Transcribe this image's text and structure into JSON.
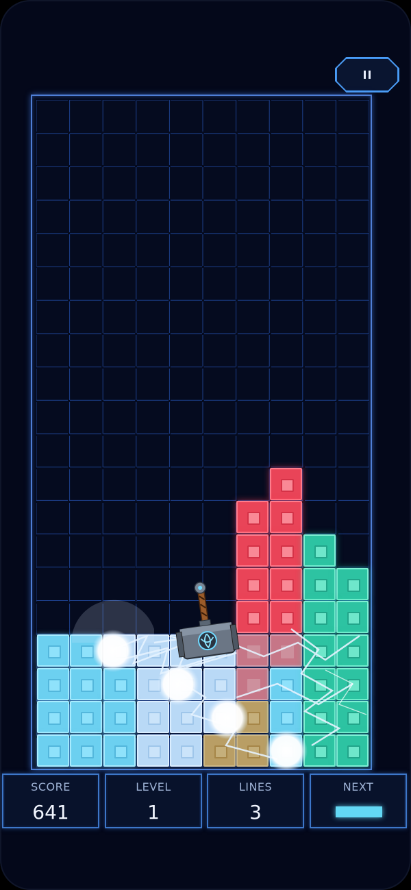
{
  "pause_button": {
    "label": "II"
  },
  "hud": {
    "score": {
      "label": "SCORE",
      "value": "641"
    },
    "level": {
      "label": "LEVEL",
      "value": "1"
    },
    "lines": {
      "label": "LINES",
      "value": "3"
    },
    "next": {
      "label": "NEXT",
      "piece": "I-piece"
    }
  },
  "board": {
    "columns": 10,
    "rows": 20,
    "blocks": [
      {
        "col": 7,
        "row": 11,
        "color": "red"
      },
      {
        "col": 6,
        "row": 12,
        "color": "red"
      },
      {
        "col": 7,
        "row": 12,
        "color": "red"
      },
      {
        "col": 6,
        "row": 13,
        "color": "red"
      },
      {
        "col": 7,
        "row": 13,
        "color": "red"
      },
      {
        "col": 8,
        "row": 13,
        "color": "green"
      },
      {
        "col": 6,
        "row": 14,
        "color": "red"
      },
      {
        "col": 7,
        "row": 14,
        "color": "red"
      },
      {
        "col": 8,
        "row": 14,
        "color": "green"
      },
      {
        "col": 9,
        "row": 14,
        "color": "green"
      },
      {
        "col": 6,
        "row": 15,
        "color": "red"
      },
      {
        "col": 7,
        "row": 15,
        "color": "red"
      },
      {
        "col": 8,
        "row": 15,
        "color": "green"
      },
      {
        "col": 9,
        "row": 15,
        "color": "green"
      },
      {
        "col": 0,
        "row": 16,
        "color": "cyan"
      },
      {
        "col": 1,
        "row": 16,
        "color": "cyan"
      },
      {
        "col": 2,
        "row": 16,
        "color": "pale"
      },
      {
        "col": 3,
        "row": 16,
        "color": "pale"
      },
      {
        "col": 4,
        "row": 16,
        "color": "pale"
      },
      {
        "col": 5,
        "row": 16,
        "color": "pale"
      },
      {
        "col": 6,
        "row": 16,
        "color": "dimred"
      },
      {
        "col": 7,
        "row": 16,
        "color": "dimred"
      },
      {
        "col": 8,
        "row": 16,
        "color": "green"
      },
      {
        "col": 9,
        "row": 16,
        "color": "green"
      },
      {
        "col": 0,
        "row": 17,
        "color": "cyan"
      },
      {
        "col": 1,
        "row": 17,
        "color": "cyan"
      },
      {
        "col": 2,
        "row": 17,
        "color": "cyan"
      },
      {
        "col": 3,
        "row": 17,
        "color": "pale"
      },
      {
        "col": 4,
        "row": 17,
        "color": "pale"
      },
      {
        "col": 5,
        "row": 17,
        "color": "pale"
      },
      {
        "col": 6,
        "row": 17,
        "color": "dimred"
      },
      {
        "col": 7,
        "row": 17,
        "color": "cyan"
      },
      {
        "col": 8,
        "row": 17,
        "color": "green"
      },
      {
        "col": 9,
        "row": 17,
        "color": "green"
      },
      {
        "col": 0,
        "row": 18,
        "color": "cyan"
      },
      {
        "col": 1,
        "row": 18,
        "color": "cyan"
      },
      {
        "col": 2,
        "row": 18,
        "color": "cyan"
      },
      {
        "col": 3,
        "row": 18,
        "color": "pale"
      },
      {
        "col": 4,
        "row": 18,
        "color": "pale"
      },
      {
        "col": 5,
        "row": 18,
        "color": "pale"
      },
      {
        "col": 6,
        "row": 18,
        "color": "gold"
      },
      {
        "col": 7,
        "row": 18,
        "color": "cyan"
      },
      {
        "col": 8,
        "row": 18,
        "color": "green"
      },
      {
        "col": 9,
        "row": 18,
        "color": "green"
      },
      {
        "col": 0,
        "row": 19,
        "color": "cyan"
      },
      {
        "col": 1,
        "row": 19,
        "color": "cyan"
      },
      {
        "col": 2,
        "row": 19,
        "color": "cyan"
      },
      {
        "col": 3,
        "row": 19,
        "color": "pale"
      },
      {
        "col": 4,
        "row": 19,
        "color": "pale"
      },
      {
        "col": 5,
        "row": 19,
        "color": "gold"
      },
      {
        "col": 6,
        "row": 19,
        "color": "gold"
      },
      {
        "col": 7,
        "row": 19,
        "color": "cyan"
      },
      {
        "col": 8,
        "row": 19,
        "color": "green"
      },
      {
        "col": 9,
        "row": 19,
        "color": "green"
      }
    ]
  },
  "effects": {
    "power_up": "hammer-icon",
    "effect": "lightning-sparks"
  },
  "colors": {
    "background": "#04081a",
    "board_border": "#4f7fd6",
    "grid_line": "#1d3f8a",
    "red": "#e94458",
    "green": "#2dc3a2",
    "cyan": "#6cd0f0",
    "next_piece": "#63d8f5"
  }
}
